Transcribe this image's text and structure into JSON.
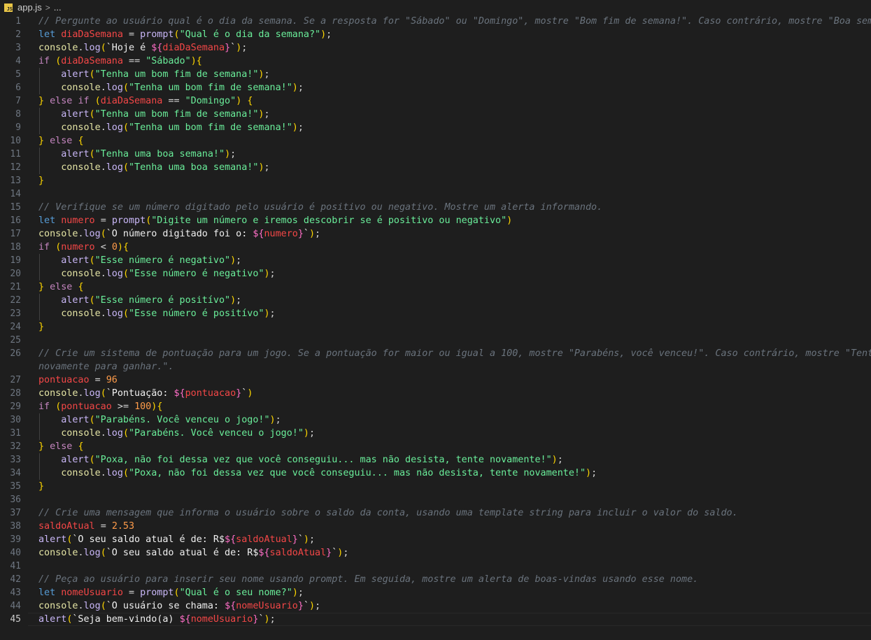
{
  "breadcrumb": {
    "file": "app.js",
    "badge": "JS",
    "separator": ">",
    "more": "..."
  },
  "active_line": 45,
  "lines": [
    {
      "n": "1",
      "indent": false,
      "text": "// Pergunte ao usuário qual é o dia da semana. Se a resposta for \"Sábado\" ou \"Domingo\", mostre \"Bom fim de semana!\". Caso contrário, mostre \"Boa semana!\".",
      "kind": "comment"
    },
    {
      "n": "2",
      "indent": false,
      "text": "let diaDaSemana = prompt(\"Qual é o dia da semana?\");",
      "kind": "code"
    },
    {
      "n": "3",
      "indent": false,
      "text": "console.log(`Hoje é ${diaDaSemana}`);",
      "kind": "code"
    },
    {
      "n": "4",
      "indent": false,
      "text": "if (diaDaSemana == \"Sábado\"){",
      "kind": "code"
    },
    {
      "n": "5",
      "indent": true,
      "text": "alert(\"Tenha um bom fim de semana!\");",
      "kind": "code"
    },
    {
      "n": "6",
      "indent": true,
      "text": "console.log(\"Tenha um bom fim de semana!\");",
      "kind": "code"
    },
    {
      "n": "7",
      "indent": false,
      "text": "} else if (diaDaSemana == \"Domingo\") {",
      "kind": "code"
    },
    {
      "n": "8",
      "indent": true,
      "text": "alert(\"Tenha um bom fim de semana!\");",
      "kind": "code"
    },
    {
      "n": "9",
      "indent": true,
      "text": "console.log(\"Tenha um bom fim de semana!\");",
      "kind": "code"
    },
    {
      "n": "10",
      "indent": false,
      "text": "} else {",
      "kind": "code"
    },
    {
      "n": "11",
      "indent": true,
      "text": "alert(\"Tenha uma boa semana!\");",
      "kind": "code"
    },
    {
      "n": "12",
      "indent": true,
      "text": "console.log(\"Tenha uma boa semana!\");",
      "kind": "code"
    },
    {
      "n": "13",
      "indent": false,
      "text": "}",
      "kind": "code"
    },
    {
      "n": "14",
      "indent": false,
      "text": "",
      "kind": "code"
    },
    {
      "n": "15",
      "indent": false,
      "text": "// Verifique se um número digitado pelo usuário é positivo ou negativo. Mostre um alerta informando.",
      "kind": "comment"
    },
    {
      "n": "16",
      "indent": false,
      "text": "let numero = prompt(\"Digite um número e iremos descobrir se é positivo ou negativo\")",
      "kind": "code"
    },
    {
      "n": "17",
      "indent": false,
      "text": "console.log(`O número digitado foi o: ${numero}`);",
      "kind": "code"
    },
    {
      "n": "18",
      "indent": false,
      "text": "if (numero < 0){",
      "kind": "code"
    },
    {
      "n": "19",
      "indent": true,
      "text": "alert(\"Esse número é negativo\");",
      "kind": "code"
    },
    {
      "n": "20",
      "indent": true,
      "text": "console.log(\"Esse número é negativo\");",
      "kind": "code"
    },
    {
      "n": "21",
      "indent": false,
      "text": "} else {",
      "kind": "code"
    },
    {
      "n": "22",
      "indent": true,
      "text": "alert(\"Esse número é positívo\");",
      "kind": "code"
    },
    {
      "n": "23",
      "indent": true,
      "text": "console.log(\"Esse número é positívo\");",
      "kind": "code"
    },
    {
      "n": "24",
      "indent": false,
      "text": "}",
      "kind": "code"
    },
    {
      "n": "25",
      "indent": false,
      "text": "",
      "kind": "code"
    },
    {
      "n": "26",
      "indent": false,
      "text": "// Crie um sistema de pontuação para um jogo. Se a pontuação for maior ou igual a 100, mostre \"Parabéns, você venceu!\". Caso contrário, mostre \"Tente",
      "kind": "comment"
    },
    {
      "n": "",
      "indent": false,
      "text": "novamente para ganhar.\".",
      "kind": "comment"
    },
    {
      "n": "27",
      "indent": false,
      "text": "pontuacao = 96",
      "kind": "code"
    },
    {
      "n": "28",
      "indent": false,
      "text": "console.log(`Pontuação: ${pontuacao}`)",
      "kind": "code"
    },
    {
      "n": "29",
      "indent": false,
      "text": "if (pontuacao >= 100){",
      "kind": "code"
    },
    {
      "n": "30",
      "indent": true,
      "text": "alert(\"Parabéns. Você venceu o jogo!\");",
      "kind": "code"
    },
    {
      "n": "31",
      "indent": true,
      "text": "console.log(\"Parabéns. Você venceu o jogo!\");",
      "kind": "code"
    },
    {
      "n": "32",
      "indent": false,
      "text": "} else {",
      "kind": "code"
    },
    {
      "n": "33",
      "indent": true,
      "text": "alert(\"Poxa, não foi dessa vez que você conseguiu... mas não desista, tente novamente!\");",
      "kind": "code"
    },
    {
      "n": "34",
      "indent": true,
      "text": "console.log(\"Poxa, não foi dessa vez que você conseguiu... mas não desista, tente novamente!\");",
      "kind": "code"
    },
    {
      "n": "35",
      "indent": false,
      "text": "}",
      "kind": "code"
    },
    {
      "n": "36",
      "indent": false,
      "text": "",
      "kind": "code"
    },
    {
      "n": "37",
      "indent": false,
      "text": "// Crie uma mensagem que informa o usuário sobre o saldo da conta, usando uma template string para incluir o valor do saldo.",
      "kind": "comment"
    },
    {
      "n": "38",
      "indent": false,
      "text": "saldoAtual = 2.53",
      "kind": "code"
    },
    {
      "n": "39",
      "indent": false,
      "text": "alert(`O seu saldo atual é de: R$${saldoAtual}`);",
      "kind": "code"
    },
    {
      "n": "40",
      "indent": false,
      "text": "console.log(`O seu saldo atual é de: R$${saldoAtual}`);",
      "kind": "code"
    },
    {
      "n": "41",
      "indent": false,
      "text": "",
      "kind": "code"
    },
    {
      "n": "42",
      "indent": false,
      "text": "// Peça ao usuário para inserir seu nome usando prompt. Em seguida, mostre um alerta de boas-vindas usando esse nome.",
      "kind": "comment"
    },
    {
      "n": "43",
      "indent": false,
      "text": "let nomeUsuario = prompt(\"Qual é o seu nome?\");",
      "kind": "code"
    },
    {
      "n": "44",
      "indent": false,
      "text": "console.log(`O usuário se chama: ${nomeUsuario}`);",
      "kind": "code"
    },
    {
      "n": "45",
      "indent": false,
      "text": "alert(`Seja bem-vindo(a) ${nomeUsuario}`);",
      "kind": "code"
    }
  ]
}
